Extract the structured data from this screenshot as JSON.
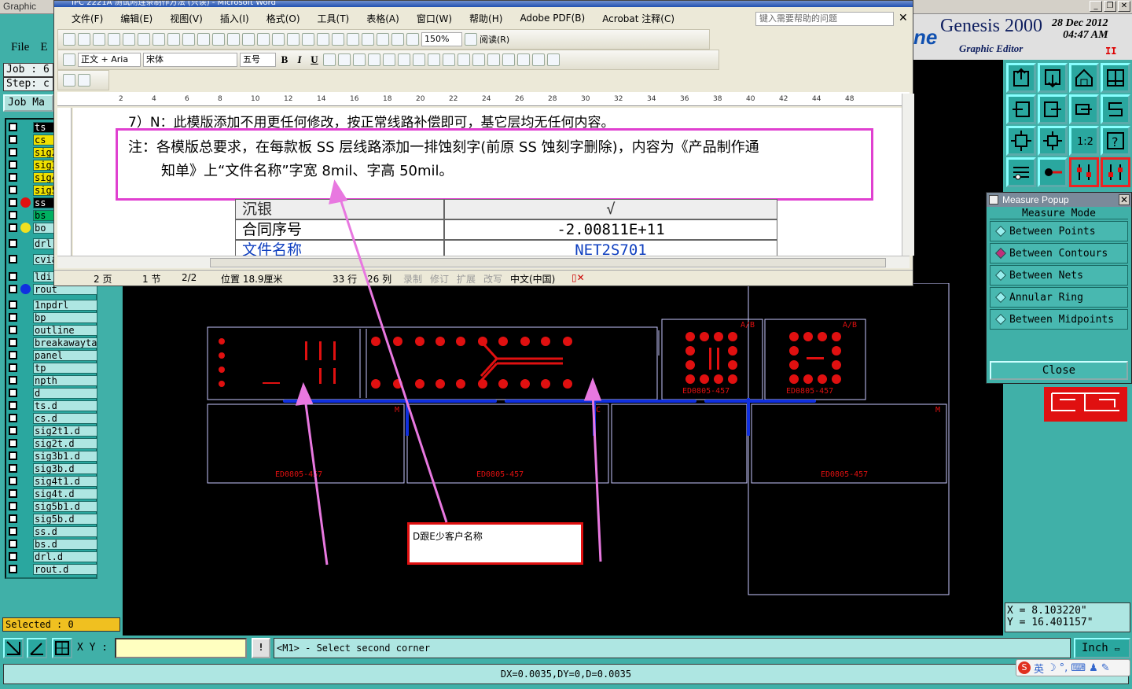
{
  "genesis": {
    "title": "Graphic",
    "menu": [
      "File",
      "E"
    ],
    "job_label": "Job : 6",
    "step_label": "Step: c",
    "job_matrix_btn": "Job Ma",
    "brand": "Genesis 2000",
    "subtitle": "Graphic Editor",
    "logo": "ne",
    "date": "28 Dec 2012",
    "time": "04:47 AM",
    "layers": [
      {
        "name": "ts",
        "cls": "black",
        "dot": ""
      },
      {
        "name": "cs",
        "cls": "yellow",
        "dot": ""
      },
      {
        "name": "sig2",
        "cls": "yellow",
        "dot": ""
      },
      {
        "name": "sig3",
        "cls": "yellow",
        "dot": ""
      },
      {
        "name": "sig4",
        "cls": "yellow",
        "dot": ""
      },
      {
        "name": "sig5",
        "cls": "yellow",
        "dot": ""
      },
      {
        "name": "ss",
        "cls": "black",
        "dot": "#e01010"
      },
      {
        "name": "bs",
        "cls": "green",
        "dot": ""
      },
      {
        "name": "bo",
        "cls": "",
        "dot": "#f0e020"
      },
      {
        "name": "drl",
        "cls": "",
        "dot": ""
      },
      {
        "name": "cvia",
        "cls": "",
        "dot": ""
      },
      {
        "name": "ldi",
        "cls": "",
        "dot": ""
      },
      {
        "name": "rout",
        "cls": "",
        "dot": "#1030e0"
      },
      {
        "name": "1npdrl",
        "cls": "",
        "dot": ""
      },
      {
        "name": "bp",
        "cls": "",
        "dot": ""
      },
      {
        "name": "outline",
        "cls": "",
        "dot": ""
      },
      {
        "name": "breakawaytab",
        "cls": "",
        "dot": ""
      },
      {
        "name": "panel",
        "cls": "",
        "dot": ""
      },
      {
        "name": "tp",
        "cls": "",
        "dot": ""
      },
      {
        "name": "npth",
        "cls": "",
        "dot": ""
      },
      {
        "name": "d",
        "cls": "",
        "dot": ""
      },
      {
        "name": "ts.d",
        "cls": "",
        "dot": ""
      },
      {
        "name": "cs.d",
        "cls": "",
        "dot": ""
      },
      {
        "name": "sig2t1.d",
        "cls": "",
        "dot": ""
      },
      {
        "name": "sig2t.d",
        "cls": "",
        "dot": ""
      },
      {
        "name": "sig3b1.d",
        "cls": "",
        "dot": ""
      },
      {
        "name": "sig3b.d",
        "cls": "",
        "dot": ""
      },
      {
        "name": "sig4t1.d",
        "cls": "",
        "dot": ""
      },
      {
        "name": "sig4t.d",
        "cls": "",
        "dot": ""
      },
      {
        "name": "sig5b1.d",
        "cls": "",
        "dot": ""
      },
      {
        "name": "sig5b.d",
        "cls": "",
        "dot": ""
      },
      {
        "name": "ss.d",
        "cls": "",
        "dot": ""
      },
      {
        "name": "bs.d",
        "cls": "",
        "dot": ""
      },
      {
        "name": "drl.d",
        "cls": "",
        "dot": ""
      },
      {
        "name": "rout.d",
        "cls": "",
        "dot": ""
      }
    ],
    "selected": "Selected : 0",
    "measure": {
      "title": "Measure Popup",
      "header": "Measure Mode",
      "options": [
        {
          "label": "Between Points",
          "on": false
        },
        {
          "label": "Between Contours",
          "on": true
        },
        {
          "label": "Between Nets",
          "on": false
        },
        {
          "label": "Annular Ring",
          "on": false
        },
        {
          "label": "Between Midpoints",
          "on": false
        }
      ],
      "close": "Close"
    },
    "coords": {
      "x": "X = 8.103220\"",
      "y": "Y = 16.401157\""
    },
    "xy_label": "X Y :",
    "xy_value": "",
    "prompt": "<M1> - Select second corner",
    "unit": "Inch",
    "status": "DX=0.0035,DY=0,D=0.0035",
    "canvas_labels": {
      "a1": "A/B",
      "a2": "A/B",
      "code": "ED0805-457",
      "m1": "M",
      "m2": "C",
      "m3": "M"
    }
  },
  "word": {
    "title": "IPC 2221A 测试附连条制作方法 (只读) - Microsoft Word",
    "menu": [
      "文件(F)",
      "编辑(E)",
      "视图(V)",
      "插入(I)",
      "格式(O)",
      "工具(T)",
      "表格(A)",
      "窗口(W)",
      "帮助(H)",
      "Adobe PDF(B)",
      "Acrobat 注释(C)"
    ],
    "help_placeholder": "键入需要帮助的问题",
    "zoom": "150%",
    "read_btn": "阅读(R)",
    "style": "正文 + Aria",
    "font": "宋体",
    "size": "五号",
    "line7": "7）N：此模版添加不用更任何修改，按正常线路补偿即可，基它层均无任何内容。",
    "note_line1": "注：各模版总要求，在每款板 SS 层线路添加一排蚀刻字(前原 SS 蚀刻字删除)，内容为《产品制作通",
    "note_line2": "知单》上“文件名称”字宽 8mil、字高 50mil。",
    "table": [
      {
        "k": "沉银",
        "v": "√"
      },
      {
        "k": "合同序号",
        "v": "-2.00811E+11"
      },
      {
        "k": "文件名称",
        "v": "NET2S701"
      }
    ],
    "status": {
      "page": "2 页",
      "section": "1 节",
      "pages": "2/2",
      "pos": "位置 18.9厘米",
      "line": "33 行",
      "col": "26 列",
      "rec": "录制",
      "rev": "修订",
      "ext": "扩展",
      "ovr": "改写",
      "lang": "中文(中国)"
    },
    "ruler_nums": [
      "2",
      "4",
      "6",
      "8",
      "10",
      "12",
      "14",
      "16",
      "18",
      "20",
      "22",
      "24",
      "26",
      "28",
      "30",
      "32",
      "34",
      "36",
      "38",
      "40",
      "42",
      "44",
      "48"
    ]
  },
  "annotation": {
    "text": "D跟E少客户名称"
  },
  "colors": {
    "teal": "#40b0a8",
    "red": "#e01010",
    "blue": "#1030e0",
    "pink": "#e878e0",
    "outline": "#c8c8ff"
  }
}
